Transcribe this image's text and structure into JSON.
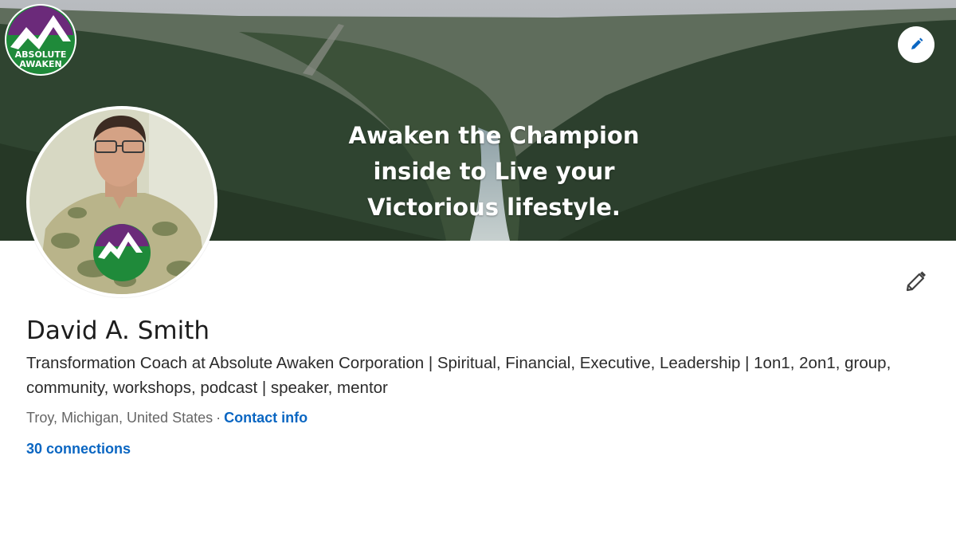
{
  "banner": {
    "quote_lines": [
      "Awaken the Champion",
      "inside to Live your",
      "Victorious lifestyle."
    ],
    "logo_text": [
      "ABSOLUTE",
      "AWAKEN"
    ]
  },
  "profile": {
    "name": "David A. Smith",
    "headline": "Transformation Coach at Absolute Awaken Corporation | Spiritual, Financial, Executive, Leadership | 1on1, 2on1, group, community, workshops, podcast | speaker, mentor",
    "location": "Troy, Michigan, United States",
    "separator": "·",
    "contact_label": "Contact info",
    "connections_label": "30 connections"
  },
  "icons": {
    "edit_cover": "pencil-icon",
    "edit_profile": "pencil-icon"
  },
  "colors": {
    "link": "#0a66c2",
    "logo_green": "#1f8a3a",
    "logo_purple": "#6b2a7a"
  }
}
